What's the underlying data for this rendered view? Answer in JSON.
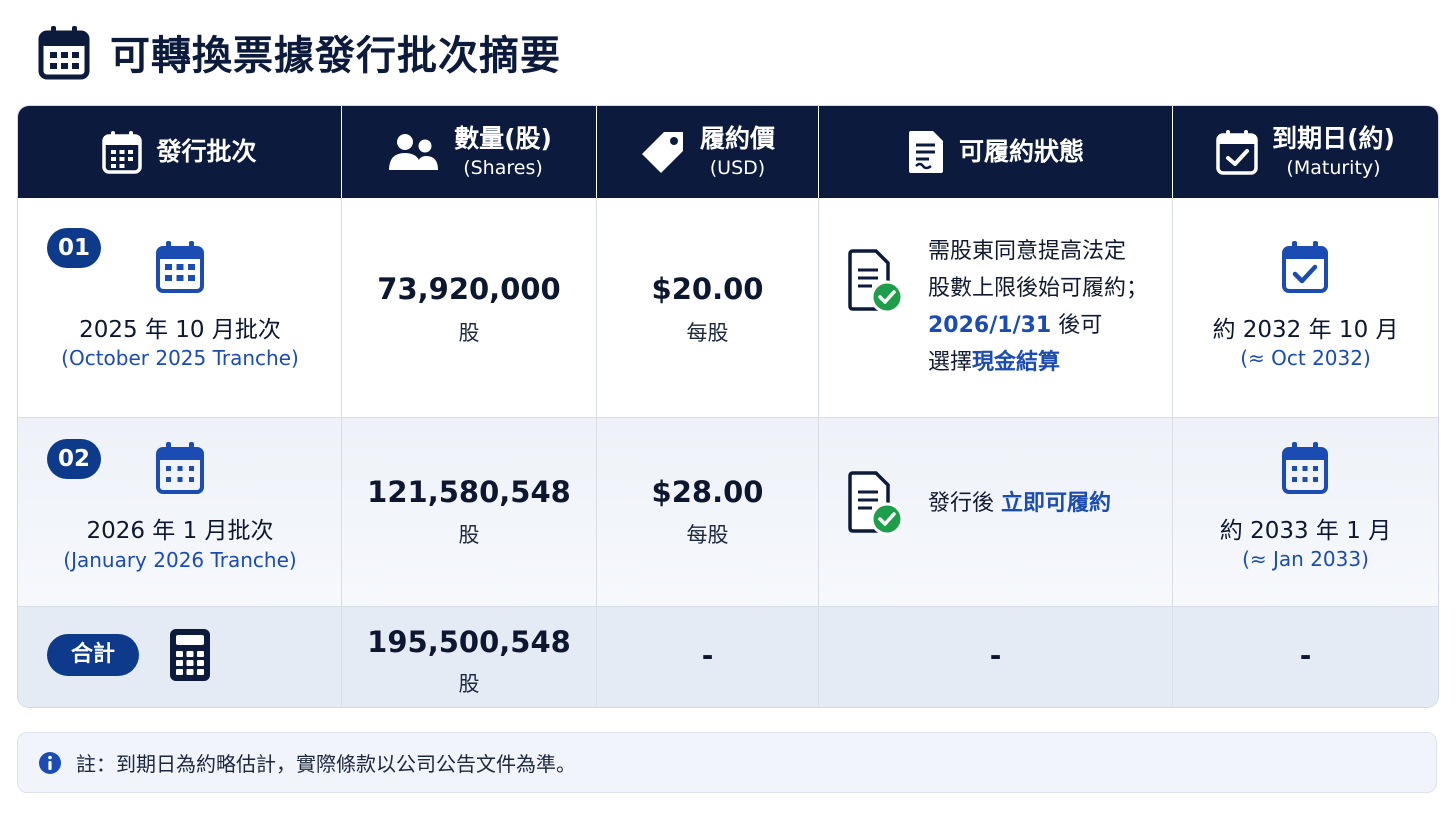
{
  "page": {
    "title": "可轉換票據發行批次摘要"
  },
  "table": {
    "headers": [
      {
        "label": "發行批次",
        "sub": "",
        "icon": "calendar-icon"
      },
      {
        "label": "數量(股)",
        "sub": "(Shares)",
        "icon": "users-icon"
      },
      {
        "label": "履約價",
        "sub": "(USD)",
        "icon": "price-tag-icon"
      },
      {
        "label": "可履約狀態",
        "sub": "",
        "icon": "document-icon"
      },
      {
        "label": "到期日(約)",
        "sub": "(Maturity)",
        "icon": "calendar-check-icon"
      }
    ],
    "rows": [
      {
        "badge": "01",
        "tranche": "2025 年 10 月批次",
        "tranche_en": "(October 2025 Tranche)",
        "shares": "73,920,000",
        "shares_unit": "股",
        "price": "$20.00",
        "price_unit": "每股",
        "status_lines": [
          "需股東同意提高法定",
          "股數上限後始可履約；"
        ],
        "status_date": "2026/1/31",
        "status_after_date": " 後可",
        "status_prefix": "選擇",
        "status_highlight": "現金結算",
        "maturity": "約 2032 年 10 月",
        "maturity_en": "(≈ Oct 2032)"
      },
      {
        "badge": "02",
        "tranche": "2026 年 1 月批次",
        "tranche_en": "(January 2026 Tranche)",
        "shares": "121,580,548",
        "shares_unit": "股",
        "price": "$28.00",
        "price_unit": "每股",
        "status_prefix": "發行後 ",
        "status_highlight": "立即可履約",
        "maturity": "約 2033 年 1 月",
        "maturity_en": "(≈ Jan 2033)"
      }
    ],
    "total": {
      "label": "合計",
      "shares": "195,500,548",
      "shares_unit": "股",
      "price": "-",
      "status": "-",
      "maturity": "-"
    }
  },
  "note": {
    "text": "註：到期日為約略估計，實際條款以公司公告文件為準。"
  },
  "colors": {
    "header_bg": "#0c1b3d",
    "accent_blue": "#1a4cb3",
    "badge_bg": "#0d3a8a",
    "check_green": "#1e9e4a"
  }
}
